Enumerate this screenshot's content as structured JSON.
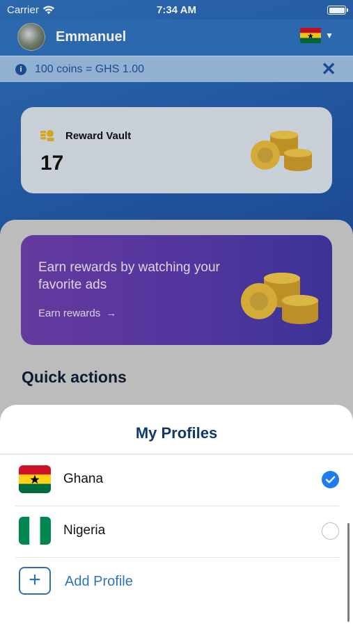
{
  "status_bar": {
    "carrier": "Carrier",
    "time": "7:34 AM",
    "icons": [
      "wifi-icon",
      "battery-icon"
    ]
  },
  "header": {
    "username": "Emmanuel",
    "country_flag": "ghana-flag-icon"
  },
  "info_banner": {
    "text": "100 coins = GHS 1.00"
  },
  "reward_vault": {
    "title": "Reward Vault",
    "value": "17"
  },
  "promo": {
    "text": "Earn rewards by watching your favorite ads",
    "link_label": "Earn rewards"
  },
  "quick_actions": {
    "title": "Quick actions"
  },
  "profiles_sheet": {
    "title": "My Profiles",
    "items": [
      {
        "label": "Ghana",
        "selected": true
      },
      {
        "label": "Nigeria",
        "selected": false
      }
    ],
    "add_label": "Add Profile"
  },
  "colors": {
    "brand_blue": "#2f6fb8",
    "promo_purple": "#6b3ea8",
    "check_blue": "#1d7cf2",
    "title_navy": "#10386f"
  }
}
